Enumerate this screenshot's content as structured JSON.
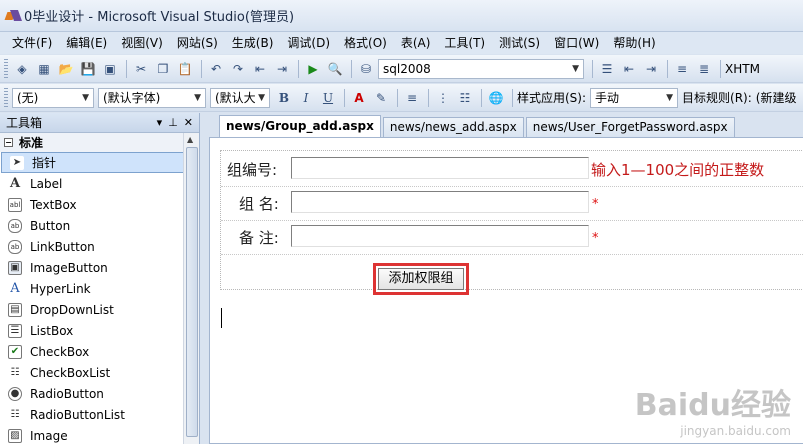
{
  "window": {
    "title": "0毕业设计 - Microsoft Visual Studio(管理员)"
  },
  "menu": [
    "文件(F)",
    "编辑(E)",
    "视图(V)",
    "网站(S)",
    "生成(B)",
    "调试(D)",
    "格式(O)",
    "表(A)",
    "工具(T)",
    "测试(S)",
    "窗口(W)",
    "帮助(H)"
  ],
  "toolbar1": {
    "db_combo": "sql2008",
    "right_label": "XHTM"
  },
  "toolbar2": {
    "block_format": "(无)",
    "font_name": "(默认字体)",
    "font_size": "(默认大",
    "bold": "B",
    "italic": "I",
    "underline": "U",
    "style_apply": "样式应用(S):",
    "style_apply_value": "手动",
    "target_rule": "目标规则(R):",
    "target_rule_value": "(新建级"
  },
  "toolbox": {
    "title": "工具箱",
    "group": "标准",
    "items": [
      {
        "label": "指针",
        "icon": "pointer-icon"
      },
      {
        "label": "Label",
        "icon": "label-icon"
      },
      {
        "label": "TextBox",
        "icon": "textbox-icon"
      },
      {
        "label": "Button",
        "icon": "button-icon"
      },
      {
        "label": "LinkButton",
        "icon": "linkbutton-icon"
      },
      {
        "label": "ImageButton",
        "icon": "imagebutton-icon"
      },
      {
        "label": "HyperLink",
        "icon": "hyperlink-icon"
      },
      {
        "label": "DropDownList",
        "icon": "dropdownlist-icon"
      },
      {
        "label": "ListBox",
        "icon": "listbox-icon"
      },
      {
        "label": "CheckBox",
        "icon": "checkbox-icon"
      },
      {
        "label": "CheckBoxList",
        "icon": "checkboxlist-icon"
      },
      {
        "label": "RadioButton",
        "icon": "radiobutton-icon"
      },
      {
        "label": "RadioButtonList",
        "icon": "radiobuttonlist-icon"
      },
      {
        "label": "Image",
        "icon": "image-icon"
      }
    ]
  },
  "tabs": [
    "news/Group_add.aspx",
    "news/news_add.aspx",
    "news/User_ForgetPassword.aspx"
  ],
  "form": {
    "group_no_label": "组编号:",
    "group_no_hint": "输入1—100之间的正整数",
    "group_name_label": "组 名:",
    "remark_label": "备 注:",
    "required_mark": "*",
    "submit_button": "添加权限组"
  },
  "watermark": {
    "main": "Baidu经验",
    "sub": "jingyan.baidu.com"
  }
}
